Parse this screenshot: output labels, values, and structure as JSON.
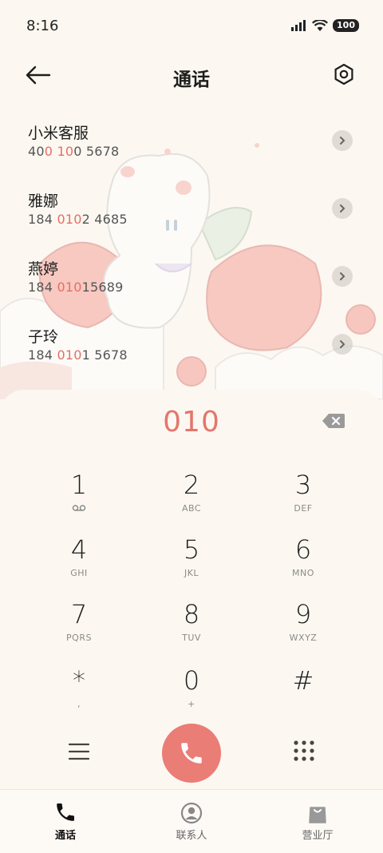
{
  "status_bar": {
    "time": "8:16",
    "battery": "100"
  },
  "header": {
    "title": "通话"
  },
  "contacts": [
    {
      "name": "小米客服",
      "number_parts": [
        "40",
        "0",
        " ",
        "10",
        "0 5678"
      ],
      "number_hl": [
        false,
        true,
        false,
        true,
        false
      ]
    },
    {
      "name": "雅娜",
      "number_parts": [
        "184 ",
        "010",
        "2 4685"
      ],
      "number_hl": [
        false,
        true,
        false
      ]
    },
    {
      "name": "燕婷",
      "number_parts": [
        "184 ",
        "010",
        "15689"
      ],
      "number_hl": [
        false,
        true,
        false
      ]
    },
    {
      "name": "子玲",
      "number_parts": [
        "184 ",
        "010",
        "1 5678"
      ],
      "number_hl": [
        false,
        true,
        false
      ]
    }
  ],
  "dialer": {
    "input": "010",
    "keys": [
      {
        "digit": "1",
        "letters": ""
      },
      {
        "digit": "2",
        "letters": "ABC"
      },
      {
        "digit": "3",
        "letters": "DEF"
      },
      {
        "digit": "4",
        "letters": "GHI"
      },
      {
        "digit": "5",
        "letters": "JKL"
      },
      {
        "digit": "6",
        "letters": "MNO"
      },
      {
        "digit": "7",
        "letters": "PQRS"
      },
      {
        "digit": "8",
        "letters": "TUV"
      },
      {
        "digit": "9",
        "letters": "WXYZ"
      },
      {
        "digit": "*",
        "letters": ","
      },
      {
        "digit": "0",
        "letters": "+"
      },
      {
        "digit": "#",
        "letters": ""
      }
    ]
  },
  "bottom_nav": [
    {
      "label": "通话",
      "icon": "phone-icon",
      "active": true
    },
    {
      "label": "联系人",
      "icon": "contacts-icon",
      "active": false
    },
    {
      "label": "营业厅",
      "icon": "store-bag-icon",
      "active": false
    }
  ],
  "colors": {
    "accent": "#e4766c",
    "call_button": "#ea7d76",
    "background": "#fcf8f1"
  }
}
